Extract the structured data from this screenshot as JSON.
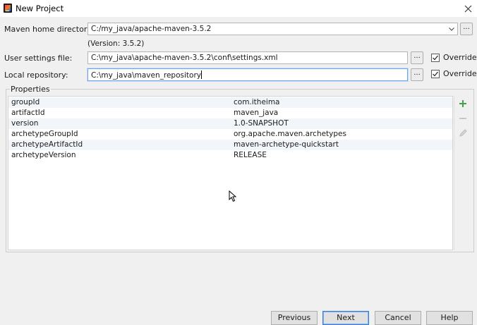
{
  "window": {
    "title": "New Project"
  },
  "maven_home": {
    "label": "Maven home directory:",
    "value": "C:/my_java/apache-maven-3.5.2",
    "version": "(Version: 3.5.2)",
    "browse_label": "..."
  },
  "user_settings": {
    "label": "User settings file:",
    "value": "C:\\my_java\\apache-maven-3.5.2\\conf\\settings.xml",
    "browse_label": "...",
    "override_label": "Override",
    "override_checked": true
  },
  "local_repo": {
    "label": "Local repository:",
    "value": "C:\\my_java\\maven_repository",
    "browse_label": "...",
    "override_label": "Override",
    "override_checked": true
  },
  "properties": {
    "legend": "Properties",
    "rows": [
      {
        "key": "groupId",
        "value": "com.itheima"
      },
      {
        "key": "artifactId",
        "value": "maven_java"
      },
      {
        "key": "version",
        "value": "1.0-SNAPSHOT"
      },
      {
        "key": "archetypeGroupId",
        "value": "org.apache.maven.archetypes"
      },
      {
        "key": "archetypeArtifactId",
        "value": "maven-archetype-quickstart"
      },
      {
        "key": "archetypeVersion",
        "value": "RELEASE"
      }
    ]
  },
  "buttons": {
    "previous": "Previous",
    "next": "Next",
    "cancel": "Cancel",
    "help": "Help"
  },
  "colors": {
    "add": "#3fa33f",
    "disabled": "#bdbdbd",
    "focus": "#6ea6e6"
  }
}
